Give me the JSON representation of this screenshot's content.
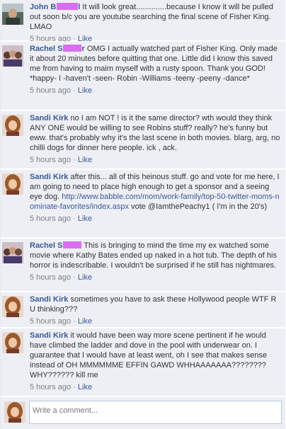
{
  "comments": [
    {
      "author": "John B",
      "author_tail": "l",
      "text": "It will look great..............because I know it will be pulled out soon b/c you are youtube searching the final scene of Fisher King. LMAO",
      "time": "5 hours ago",
      "like": "Like",
      "avatar": "man"
    },
    {
      "author": "Rachel S",
      "author_tail": "r",
      "text": "OMG I actually watched part of Fisher King. Only made it about 20 minutes before quitting that one. Little did I know this saved me from having to maim myself with a rusty spoon. Thank you GOD! *happy- I -haven't -seen- Robin -Williams -teeny -peeny -dance*",
      "time": "5 hours ago",
      "like": "Like",
      "avatar": "group"
    },
    {
      "author": "Sandi Kirk",
      "author_tail": "",
      "text": "no I am NOT ! is it the same director? wth would they think ANY ONE would be willing to see Robins stuff? really? he's funny but eww. that's probably why it's the last scene in both movies. blarg, arg, no chilli dogs for dinner here people. ick , ack.",
      "time": "5 hours ago",
      "like": "Like",
      "avatar": "woman"
    },
    {
      "author": "Sandi Kirk",
      "author_tail": "",
      "text": "after this... all of this heinous stuff. go and vote for me here, I am going to need to place high enough to get a sponsor and a seeing eye dog. ",
      "link": "http://www.babble.com/mom/work-family/top-50-twitter-moms-nominate-favorites/index.aspx",
      "text_after": " vote @IamthePeachy1 ( I'm in the 20's)",
      "time": "5 hours ago",
      "like": "Like",
      "avatar": "woman"
    },
    {
      "author": "Rachel S",
      "author_tail": "",
      "text": "This is bringing to mind the time my ex watched some movie where Kathy Bates ended up naked in a hot tub. The depth of his horror is indescribable. I wouldn't be surprised if he still has nightmares.",
      "time": "5 hours ago",
      "like": "Like",
      "avatar": "group"
    },
    {
      "author": "Sandi Kirk",
      "author_tail": "",
      "text": "sometimes you have to ask these Hollywood people WTF R U thinking???",
      "time": "5 hours ago",
      "like": "Like",
      "avatar": "woman"
    },
    {
      "author": "Sandi Kirk",
      "author_tail": "",
      "text": "it would have been way more scene pertinent if he would have climbed the ladder and dove in the pool with underwear on. I guarantee that I would have at least went, oh I see that makes sense instead of OH MMMMMME EFFIN GAWD WHHAAAAAAA???????? WHY?????? kill me",
      "time": "5 hours ago",
      "like": "Like",
      "avatar": "woman"
    }
  ],
  "write_box": {
    "placeholder": "Write a comment..."
  },
  "separator": " · ",
  "colors": {
    "link": "#3b5998",
    "bg": "#edeff4",
    "redaction": "#d96ef0"
  }
}
